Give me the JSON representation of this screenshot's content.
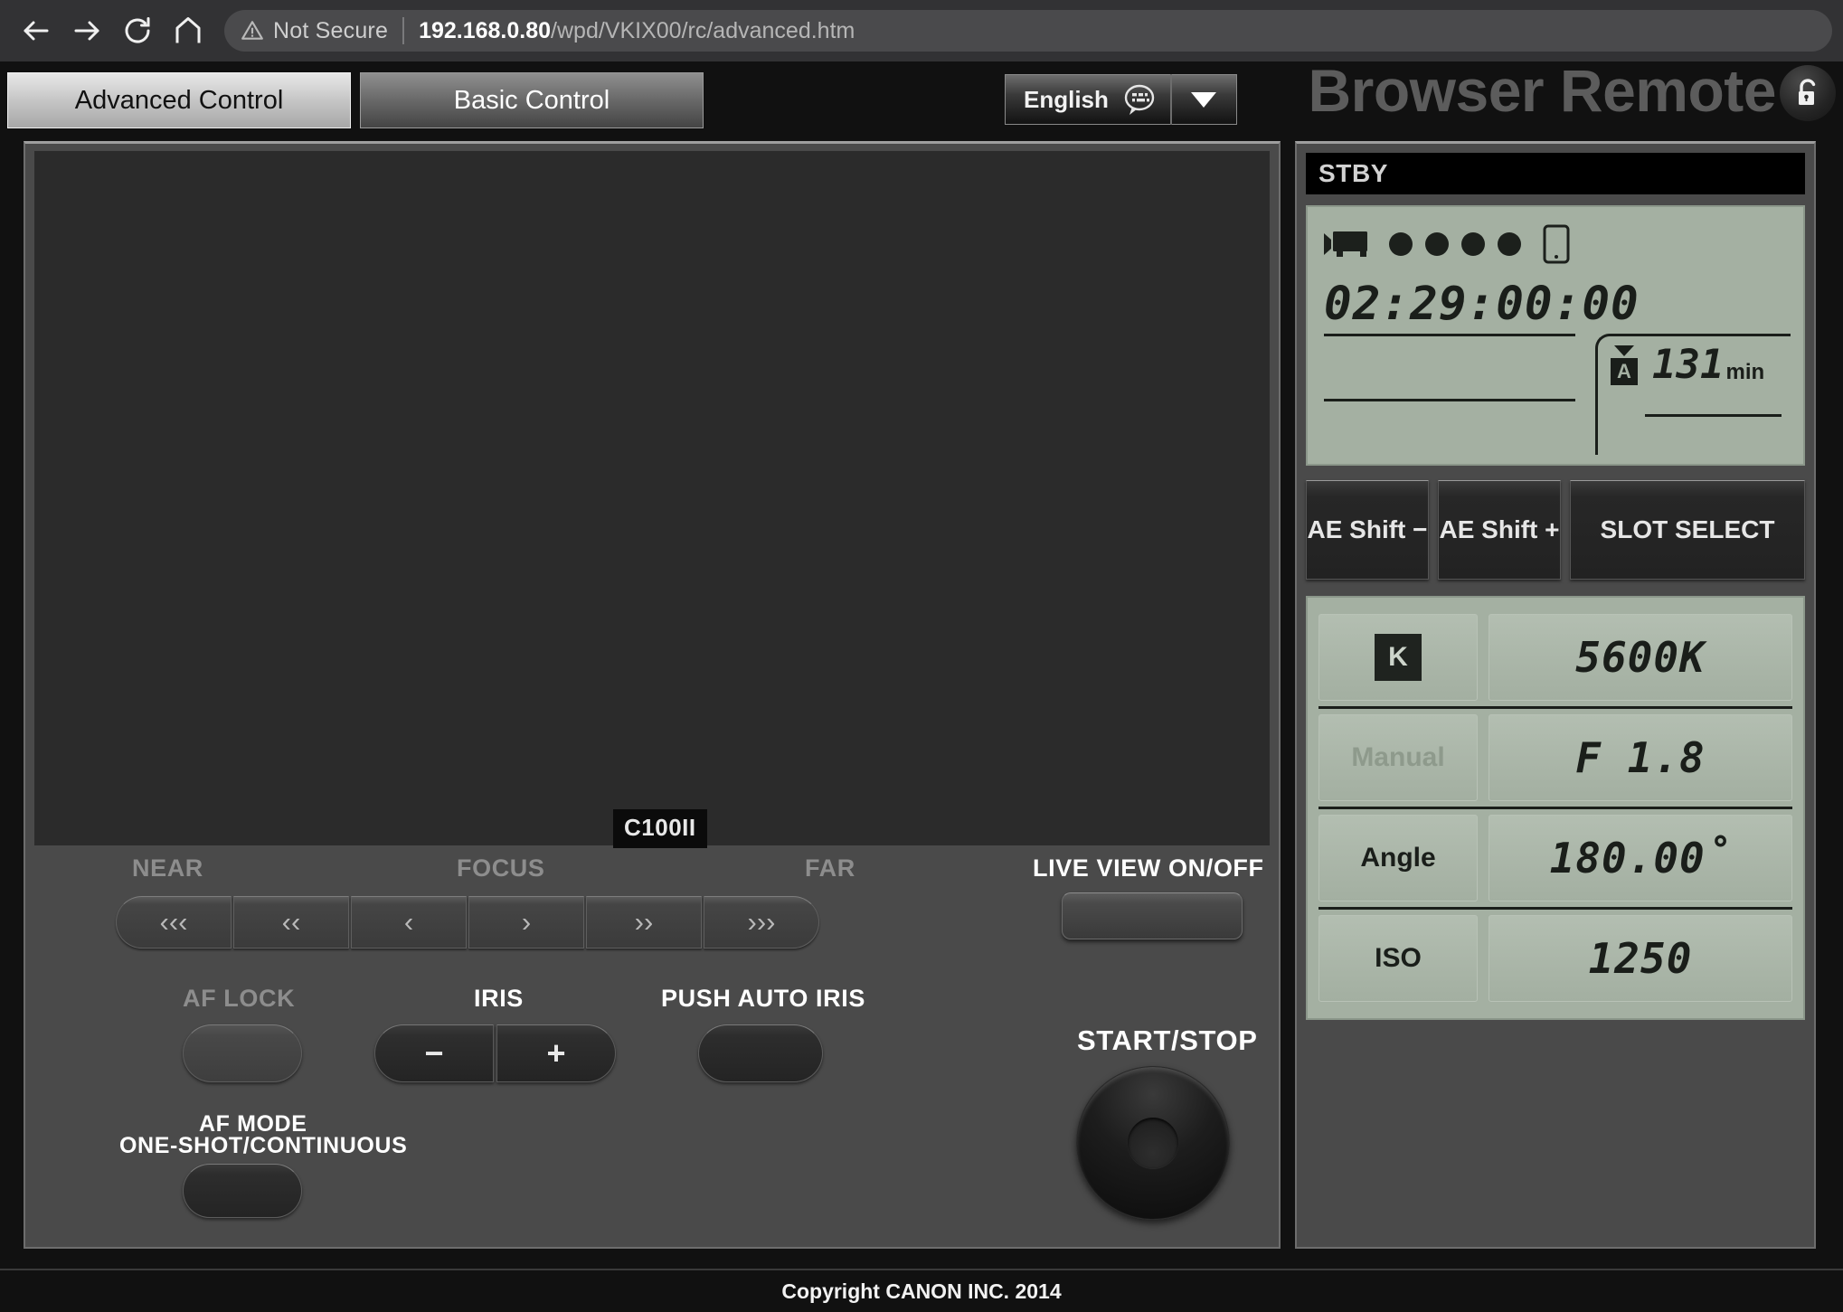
{
  "browser": {
    "back_label": "back-arrow",
    "forward_label": "forward-arrow",
    "reload_label": "reload",
    "home_label": "home",
    "security_text": "Not Secure",
    "url_host": "192.168.0.80",
    "url_path": "/wpd/VKIX00/rc/advanced.htm"
  },
  "header": {
    "tabs": [
      {
        "label": "Advanced Control",
        "active": true
      },
      {
        "label": "Basic Control",
        "active": false
      }
    ],
    "language": {
      "value": "English",
      "bubble_icon": "speech-keyboard-icon",
      "arrow_icon": "chevron-down-icon"
    },
    "title": "Browser Remote",
    "lock_icon": "unlock-icon"
  },
  "liveview": {
    "camera_badge": "C100II"
  },
  "focus": {
    "near_label": "NEAR",
    "focus_label": "FOCUS",
    "far_label": "FAR",
    "buttons": [
      {
        "label": "‹‹‹",
        "name": "focus-near-fast"
      },
      {
        "label": "‹‹",
        "name": "focus-near-med"
      },
      {
        "label": "‹",
        "name": "focus-near-slow"
      },
      {
        "label": "›",
        "name": "focus-far-slow"
      },
      {
        "label": "››",
        "name": "focus-far-med"
      },
      {
        "label": "›››",
        "name": "focus-far-fast"
      }
    ]
  },
  "controls": {
    "af_lock_label": "AF LOCK",
    "iris_label": "IRIS",
    "iris_minus": "−",
    "iris_plus": "+",
    "push_auto_iris_label": "PUSH AUTO IRIS",
    "af_mode_label_line1": "AF MODE",
    "af_mode_label_line2": "ONE-SHOT/CONTINUOUS",
    "live_view_label": "LIVE  VIEW  ON/OFF",
    "start_stop_label": "START/STOP"
  },
  "status": {
    "recording_state": "STBY",
    "camera_icon": "video-camera-icon",
    "battery_dots": 4,
    "device_icon": "smartphone-icon",
    "timecode": "02:29:00:00",
    "slot_label": "A",
    "slot_triangle_icon": "triangle-down-icon",
    "remaining_value": "131",
    "remaining_unit": "min"
  },
  "ae_buttons": [
    {
      "label": "AE Shift −",
      "name": "ae-shift-minus-button"
    },
    {
      "label": "AE Shift +",
      "name": "ae-shift-plus-button"
    },
    {
      "label": "SLOT SELECT",
      "name": "slot-select-button"
    }
  ],
  "settings": [
    {
      "key": "K",
      "key_type": "boxed",
      "value": "5600K",
      "name": "white-balance"
    },
    {
      "key": "Manual",
      "key_type": "muted",
      "value": "F 1.8",
      "name": "iris-mode"
    },
    {
      "key": "Angle",
      "key_type": "normal",
      "value": "180.00˚",
      "name": "shutter-angle"
    },
    {
      "key": "ISO",
      "key_type": "normal",
      "value": "1250",
      "name": "iso"
    }
  ],
  "footer": {
    "copyright": "Copyright CANON INC. 2014"
  },
  "colors": {
    "panel_bg": "#4a4a4a",
    "lcd_bg": "#a4b0a2",
    "lcd_fg": "#1a1e1a",
    "accent_active_tab": "#c9c9c9"
  }
}
